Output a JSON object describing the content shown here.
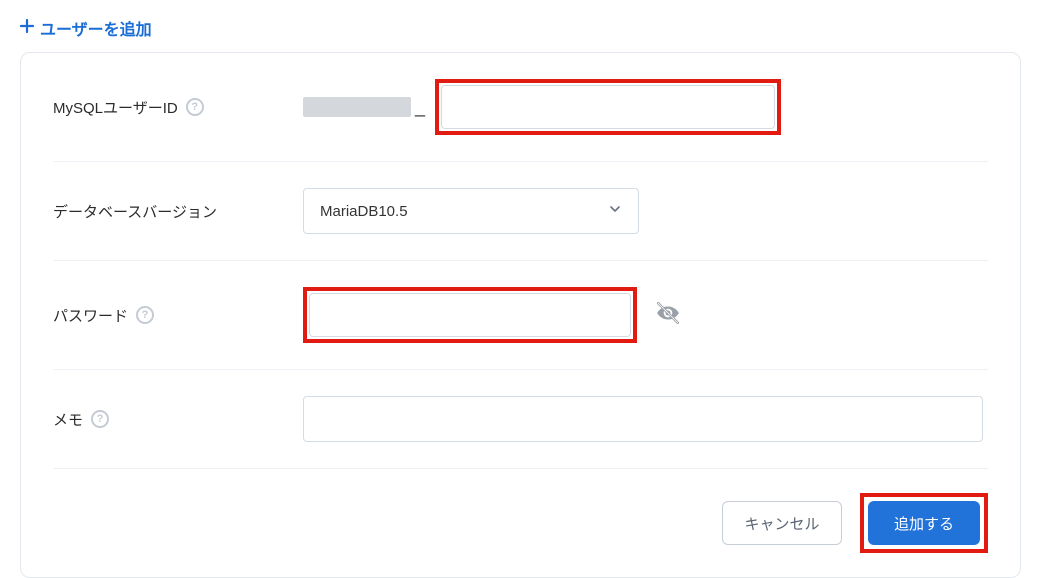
{
  "header": {
    "title": "ユーザーを追加"
  },
  "form": {
    "user_id": {
      "label": "MySQLユーザーID",
      "value": ""
    },
    "db_version": {
      "label": "データベースバージョン",
      "selected": "MariaDB10.5"
    },
    "password": {
      "label": "パスワード",
      "value": ""
    },
    "memo": {
      "label": "メモ",
      "value": ""
    }
  },
  "actions": {
    "cancel": "キャンセル",
    "submit": "追加する"
  }
}
